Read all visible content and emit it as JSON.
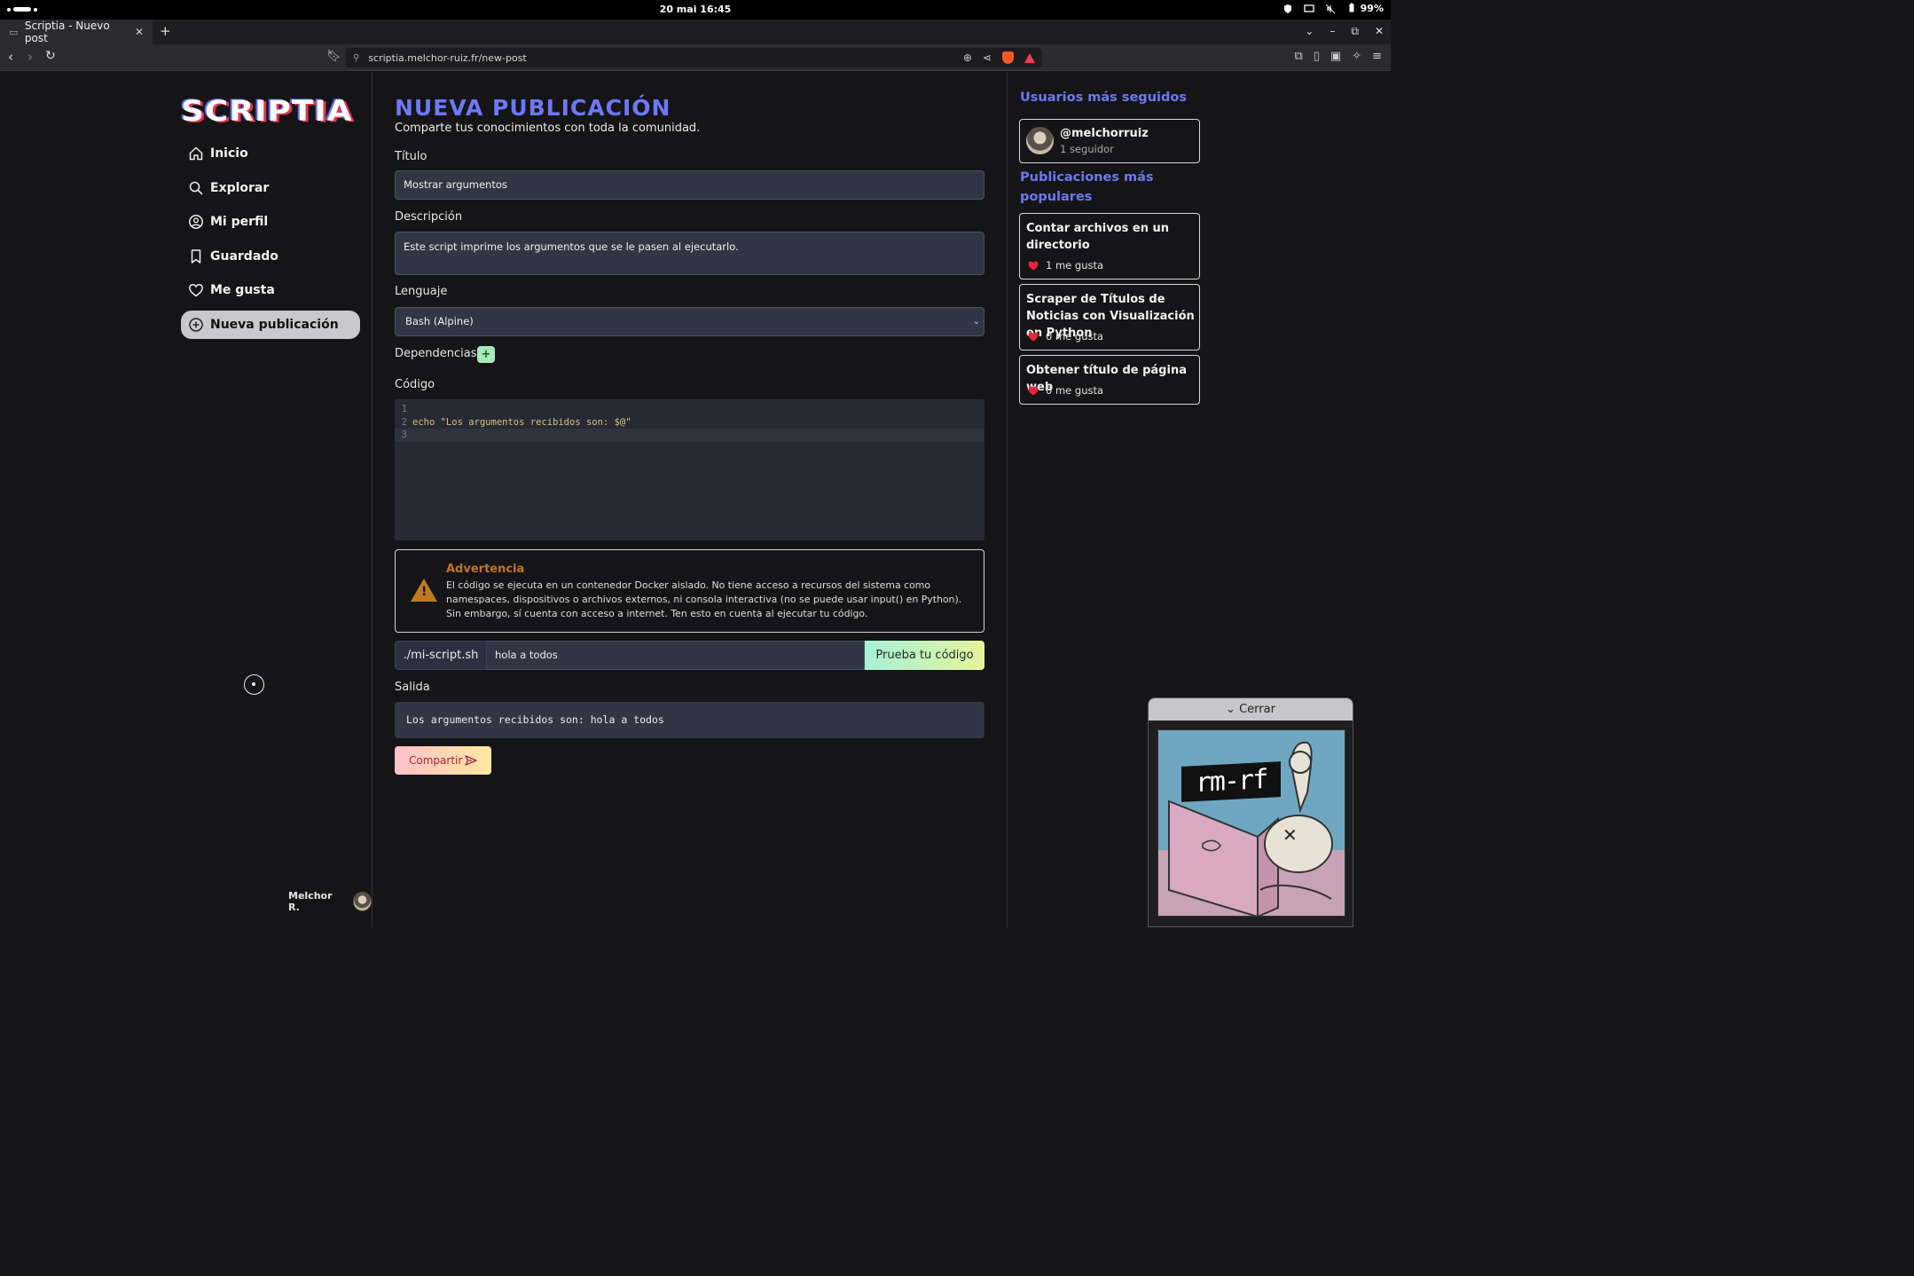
{
  "os": {
    "clock": "20 mai  16:45",
    "battery": "99%"
  },
  "browser": {
    "tab_title": "Scriptia - Nuevo post",
    "url": "scriptia.melchor-ruiz.fr/new-post"
  },
  "sidebar": {
    "logo": "SCRIPTIA",
    "items": [
      {
        "label": "Inicio",
        "icon": "home-icon"
      },
      {
        "label": "Explorar",
        "icon": "search-icon"
      },
      {
        "label": "Mi perfil",
        "icon": "user-circle-icon"
      },
      {
        "label": "Guardado",
        "icon": "bookmark-icon"
      },
      {
        "label": "Me gusta",
        "icon": "heart-icon"
      },
      {
        "label": "Nueva publicación",
        "icon": "plus-circle-icon",
        "active": true
      }
    ],
    "user_name": "Melchor R."
  },
  "main": {
    "title": "NUEVA PUBLICACIÓN",
    "subtitle": "Comparte tus conocimientos con toda la comunidad.",
    "title_label": "Título",
    "title_value": "Mostrar argumentos",
    "description_label": "Descripción",
    "description_value": "Este script imprime los argumentos que se le pasen al ejecutarlo.",
    "language_label": "Lenguaje",
    "language_value": "Bash (Alpine)",
    "dependencies_label": "Dependencias",
    "dependencies_add": "+",
    "code_label": "Código",
    "code_lines": [
      {
        "n": "1",
        "text": ""
      },
      {
        "n": "2",
        "text": "echo \"Los argumentos recibidos son: $@\""
      },
      {
        "n": "3",
        "text": ""
      }
    ],
    "warning_title": "Advertencia",
    "warning_text": "El código se ejecuta en un contenedor Docker aislado. No tiene acceso a recursos del sistema como namespaces, dispositivos o archivos externos, ni consola interactiva (no se puede usar input() en Python). Sin embargo, sí cuenta con acceso a internet. Ten esto en cuenta al ejecutar tu código.",
    "script_prefix": "./mi-script.sh",
    "args_value": "hola a todos",
    "run_button": "Prueba tu código",
    "output_label": "Salida",
    "output_value": "Los argumentos recibidos son: hola a todos",
    "share_button": "Compartir"
  },
  "right": {
    "top_users_title": "Usuarios más seguidos",
    "users": [
      {
        "handle": "@melchorruiz",
        "followers": "1 seguidor"
      }
    ],
    "popular_title": "Publicaciones más populares",
    "posts": [
      {
        "title": "Contar archivos en un directorio",
        "likes": "1 me gusta"
      },
      {
        "title": "Scraper de Títulos de Noticias con Visualización en Python",
        "likes": "0 me gusta"
      },
      {
        "title": "Obtener título de página web",
        "likes": "0 me gusta"
      }
    ]
  },
  "floating": {
    "close_label": "Cerrar",
    "image_text": "rm-rf"
  }
}
